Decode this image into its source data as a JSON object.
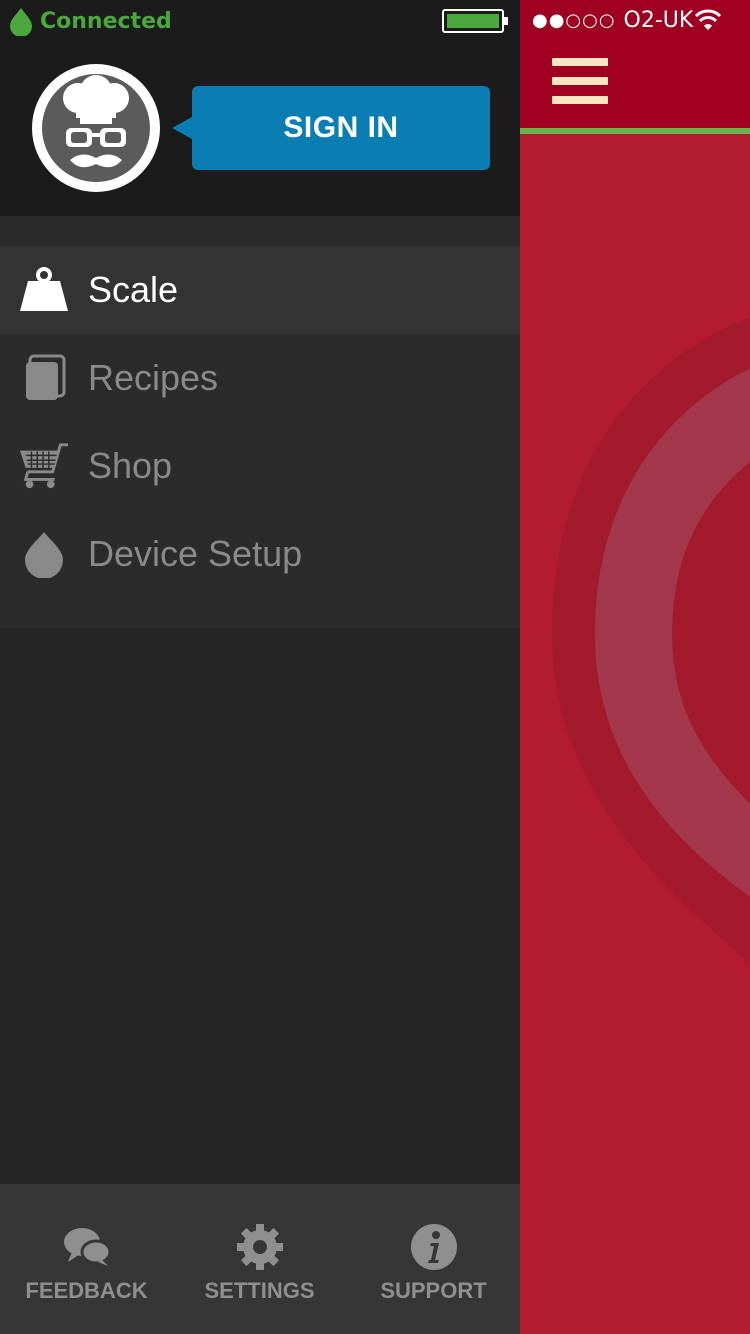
{
  "status_bar": {
    "connection_label": "Connected",
    "carrier": "O2-UK",
    "signal_bars": "●●○○○"
  },
  "profile": {
    "signin_label": "SIGN IN"
  },
  "menu": {
    "items": [
      {
        "label": "Scale",
        "icon": "scale-weight-icon",
        "active": true
      },
      {
        "label": "Recipes",
        "icon": "recipes-book-icon",
        "active": false
      },
      {
        "label": "Shop",
        "icon": "shopping-cart-icon",
        "active": false
      },
      {
        "label": "Device Setup",
        "icon": "device-drop-icon",
        "active": false
      }
    ]
  },
  "bottom_bar": {
    "feedback_label": "FEEDBACK",
    "settings_label": "SETTINGS",
    "support_label": "SUPPORT"
  },
  "colors": {
    "drawer_bg": "#262626",
    "accent_blue": "#0a7db3",
    "connected_green": "#4aa83c",
    "main_red": "#b31b31",
    "header_red": "#a00020"
  }
}
